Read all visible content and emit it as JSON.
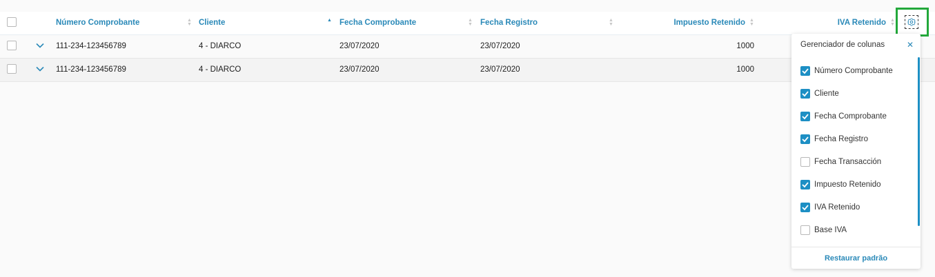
{
  "colors": {
    "accent": "#2a89b8",
    "checkbox_checked": "#1d8fc4",
    "highlight_border": "#22a83a"
  },
  "header": {
    "columns": [
      {
        "label": "Número Comprobante"
      },
      {
        "label": "Cliente"
      },
      {
        "label": "Fecha Comprobante"
      },
      {
        "label": "Fecha Registro"
      },
      {
        "label": "Impuesto Retenido"
      },
      {
        "label": "IVA Retenido"
      }
    ],
    "sorted_column": "Cliente",
    "settings_icon": "gear-icon"
  },
  "rows": [
    {
      "numero": "111-234-123456789",
      "cliente": "4 - DIARCO",
      "fecha_comprobante": "23/07/2020",
      "fecha_registro": "23/07/2020",
      "impuesto": "1000"
    },
    {
      "numero": "111-234-123456789",
      "cliente": "4 - DIARCO",
      "fecha_comprobante": "23/07/2020",
      "fecha_registro": "23/07/2020",
      "impuesto": "1000"
    }
  ],
  "column_manager": {
    "title": "Gerenciador de colunas",
    "close_icon": "close-icon",
    "options": [
      {
        "label": "Número Comprobante",
        "checked": true
      },
      {
        "label": "Cliente",
        "checked": true
      },
      {
        "label": "Fecha Comprobante",
        "checked": true
      },
      {
        "label": "Fecha Registro",
        "checked": true
      },
      {
        "label": "Fecha Transacción",
        "checked": false
      },
      {
        "label": "Impuesto Retenido",
        "checked": true
      },
      {
        "label": "IVA Retenido",
        "checked": true
      },
      {
        "label": "Base IVA",
        "checked": false
      }
    ],
    "restore_label": "Restaurar padrão"
  }
}
